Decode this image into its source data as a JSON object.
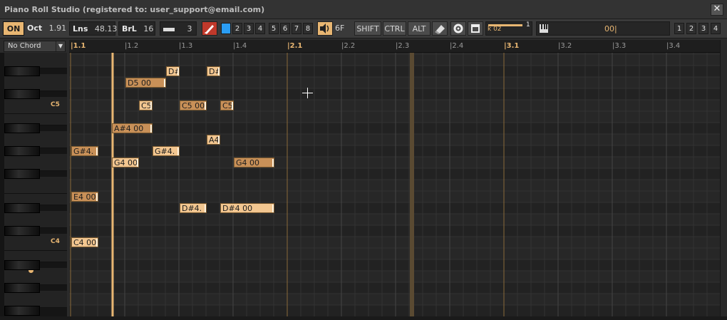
{
  "window": {
    "title": "Piano Roll Studio  (registered to: user_support@email.com)",
    "close_label": "✕"
  },
  "toolbar": {
    "on_label": "ON",
    "oct_label": "Oct",
    "oct_value": "1.91",
    "lns_label": "Lns",
    "lns_value": "48.13",
    "brl_label": "BrL",
    "brl_value": "16",
    "line_value": "3",
    "num_keys": [
      "2",
      "3",
      "4",
      "5",
      "6",
      "7",
      "8"
    ],
    "vel_value": "6F",
    "shift_label": "SHIFT",
    "ctrl_label": "CTRL",
    "alt_label": "ALT",
    "slider_label": "k 02",
    "slider_value": "1",
    "position_value": "00|",
    "view_keys": [
      "1",
      "2",
      "3",
      "4"
    ],
    "accent_color": "#e8b672",
    "selected_key_color": "#2a9df4"
  },
  "chord": {
    "selected": "No Chord"
  },
  "ruler": {
    "labels": [
      "1.1",
      "1.2",
      "1.3",
      "1.4",
      "2.1",
      "2.2",
      "2.3",
      "2.4",
      "3.1",
      "3.2",
      "3.3",
      "3.4"
    ]
  },
  "keyboard": {
    "octave_labels": [
      "C5",
      "C4"
    ]
  },
  "notes": [
    {
      "label": "D#",
      "pitch": "D#5",
      "tone": "hi"
    },
    {
      "label": "D#",
      "pitch": "D#5",
      "tone": "hi"
    },
    {
      "label": "D5 00",
      "pitch": "D5",
      "tone": "lo"
    },
    {
      "label": "C5",
      "pitch": "C5",
      "tone": "hi"
    },
    {
      "label": "C5 00",
      "pitch": "C5",
      "tone": "lo"
    },
    {
      "label": "C5",
      "pitch": "C5",
      "tone": "lo"
    },
    {
      "label": "A#4 00",
      "pitch": "A#4",
      "tone": "lo"
    },
    {
      "label": "A4",
      "pitch": "A4",
      "tone": "hi"
    },
    {
      "label": "G#4.",
      "pitch": "G#4",
      "tone": "lo"
    },
    {
      "label": "G#4.",
      "pitch": "G#4",
      "tone": "hi"
    },
    {
      "label": "G4 00",
      "pitch": "G4",
      "tone": "hi"
    },
    {
      "label": "G4 00",
      "pitch": "G4",
      "tone": "lo"
    },
    {
      "label": "E4 00",
      "pitch": "E4",
      "tone": "lo"
    },
    {
      "label": "D#4.",
      "pitch": "D#4",
      "tone": "hi"
    },
    {
      "label": "D#4 00",
      "pitch": "D#4",
      "tone": "hi"
    },
    {
      "label": "C4 00",
      "pitch": "C4",
      "tone": "hi"
    }
  ]
}
